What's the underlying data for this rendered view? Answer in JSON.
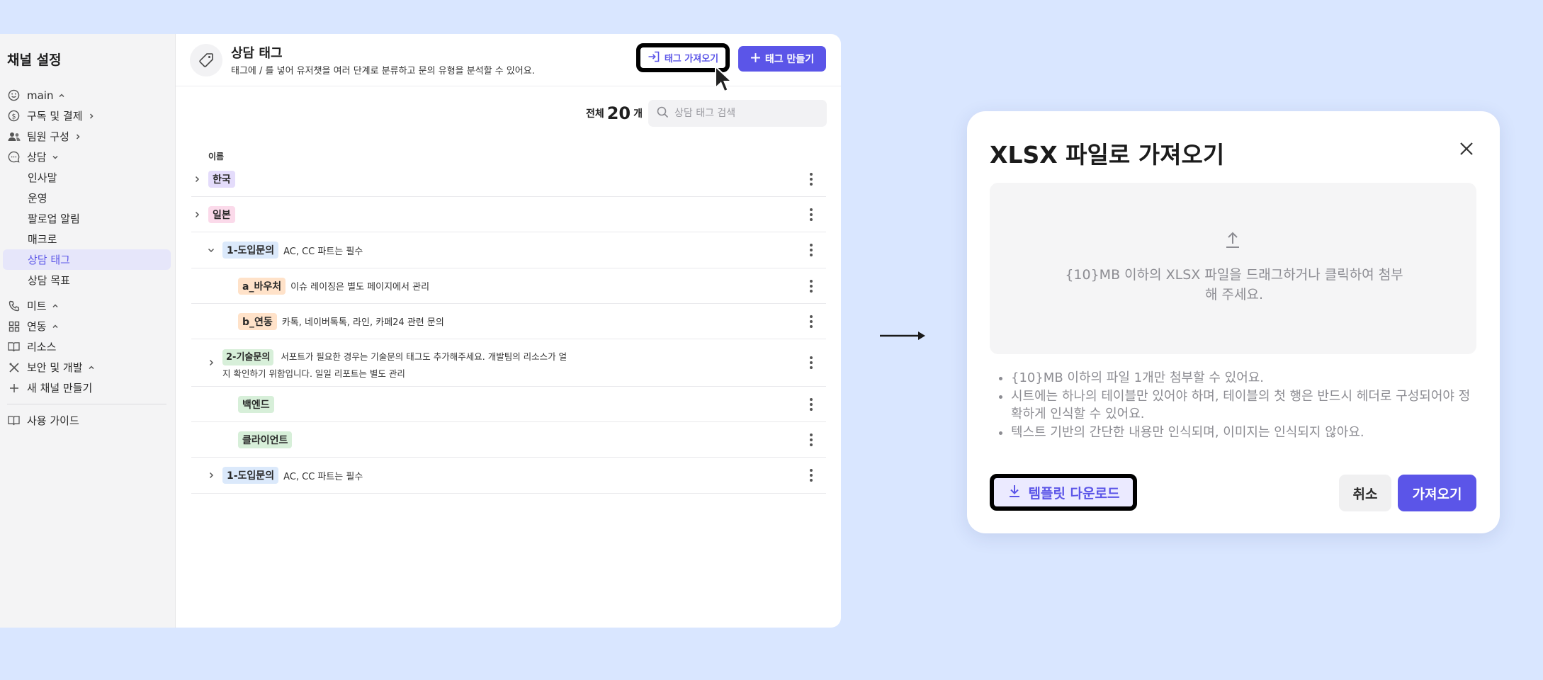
{
  "sidebar": {
    "title": "채널 설정",
    "items": [
      {
        "label": "main",
        "icon": "smile-icon"
      },
      {
        "label": "구독 및 결제",
        "icon": "dollar-icon"
      },
      {
        "label": "팀원 구성",
        "icon": "users-icon"
      },
      {
        "label": "상담",
        "icon": "chat-icon"
      },
      {
        "label": "인사말"
      },
      {
        "label": "운영"
      },
      {
        "label": "팔로업 알림"
      },
      {
        "label": "매크로"
      },
      {
        "label": "상담 태그"
      },
      {
        "label": "상담 목표"
      },
      {
        "label": "미트",
        "icon": "phone-icon"
      },
      {
        "label": "연동",
        "icon": "grid-icon"
      },
      {
        "label": "리소스",
        "icon": "book-icon"
      },
      {
        "label": "보안 및 개발",
        "icon": "tools-icon"
      },
      {
        "label": "새 채널 만들기",
        "icon": "plus-icon"
      },
      {
        "label": "사용 가이드",
        "icon": "book-icon"
      }
    ]
  },
  "header": {
    "title": "상담 태그",
    "description": "태그에 / 를 넣어 유저챗을 여러 단계로 분류하고 문의 유형을 분석할 수 있어요.",
    "import_label": "태그 가져오기",
    "create_label": "태그 만들기"
  },
  "count": {
    "prefix": "전체",
    "value": "20",
    "suffix": "개"
  },
  "search": {
    "placeholder": "상담 태그 검색"
  },
  "table": {
    "name_header": "이름",
    "rows": [
      {
        "tag": "한국",
        "desc": ""
      },
      {
        "tag": "일본",
        "desc": ""
      },
      {
        "tag": "1-도입문의",
        "desc": "AC, CC 파트는 필수"
      },
      {
        "tag": "a_바우처",
        "desc": "이슈 레이징은 별도 페이지에서 관리"
      },
      {
        "tag": "b_연동",
        "desc": "카톡, 네이버톡톡, 라인, 카페24 관련 문의"
      },
      {
        "tag": "2-기술문의",
        "desc": "서포트가 필요한 경우는 기술문의 태그도 추가해주세요. 개발팀의 리소스가 얼",
        "desc2": "지 확인하기 위함입니다. 일일 리포트는 별도 관리"
      },
      {
        "tag": "백엔드",
        "desc": ""
      },
      {
        "tag": "클라이언트",
        "desc": ""
      },
      {
        "tag": "1-도입문의",
        "desc": "AC, CC 파트는 필수"
      }
    ]
  },
  "modal": {
    "title": "XLSX 파일로 가져오기",
    "dropzone_text": "{10}MB 이하의  XLSX 파일을 드래그하거나 클릭하여 첨부해 주세요.",
    "notes": [
      "{10}MB 이하의 파일 1개만 첨부할 수 있어요.",
      "시트에는 하나의 테이블만 있어야 하며, 테이블의 첫 행은 반드시 헤더로 구성되어야 정확하게 인식할 수 있어요.",
      "텍스트 기반의 간단한 내용만 인식되며, 이미지는 인식되지 않아요."
    ],
    "template_label": "템플릿 다운로드",
    "cancel_label": "취소",
    "confirm_label": "가져오기"
  },
  "colors": {
    "accent": "#5b55e8",
    "background": "#d9e6ff"
  }
}
